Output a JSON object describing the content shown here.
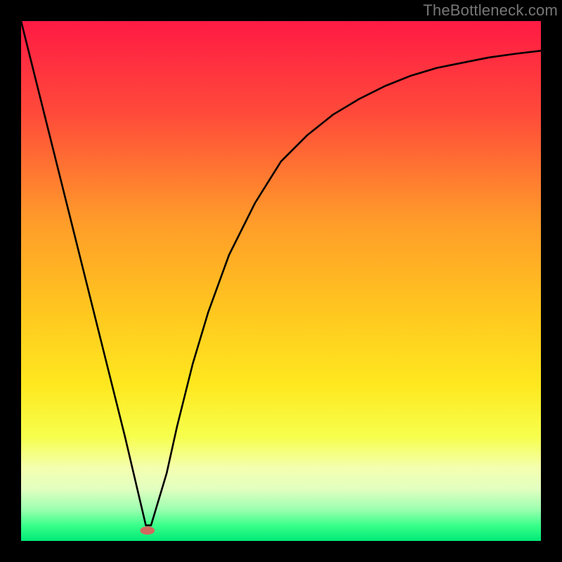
{
  "watermark": "TheBottleneck.com",
  "chart_data": {
    "type": "line",
    "title": "",
    "xlabel": "",
    "ylabel": "",
    "xlim": [
      0,
      100
    ],
    "ylim": [
      0,
      100
    ],
    "grid": false,
    "legend": false,
    "series": [
      {
        "name": "curve",
        "x": [
          0,
          5,
          10,
          15,
          20,
          24,
          25,
          28,
          30,
          33,
          36,
          40,
          45,
          50,
          55,
          60,
          65,
          70,
          75,
          80,
          85,
          90,
          95,
          100
        ],
        "y": [
          100,
          80,
          60,
          40,
          20,
          3,
          3,
          13,
          22,
          34,
          44,
          55,
          65,
          73,
          78,
          82,
          85,
          87.5,
          89.5,
          91,
          92,
          93,
          93.7,
          94.3
        ]
      }
    ],
    "marker": {
      "x": 24.3,
      "y": 2,
      "rx": 1.4,
      "ry": 0.8,
      "color": "#d1695e"
    },
    "background_gradient": {
      "stops": [
        {
          "offset": 0,
          "color": "#ff1a44"
        },
        {
          "offset": 18,
          "color": "#ff4b3a"
        },
        {
          "offset": 38,
          "color": "#ff9a2a"
        },
        {
          "offset": 55,
          "color": "#ffc51f"
        },
        {
          "offset": 70,
          "color": "#ffe81f"
        },
        {
          "offset": 80,
          "color": "#f6ff4d"
        },
        {
          "offset": 86,
          "color": "#f4ffb0"
        },
        {
          "offset": 90,
          "color": "#e2ffc0"
        },
        {
          "offset": 94,
          "color": "#9bffb0"
        },
        {
          "offset": 97,
          "color": "#39ff89"
        },
        {
          "offset": 100,
          "color": "#00ea77"
        }
      ]
    }
  }
}
